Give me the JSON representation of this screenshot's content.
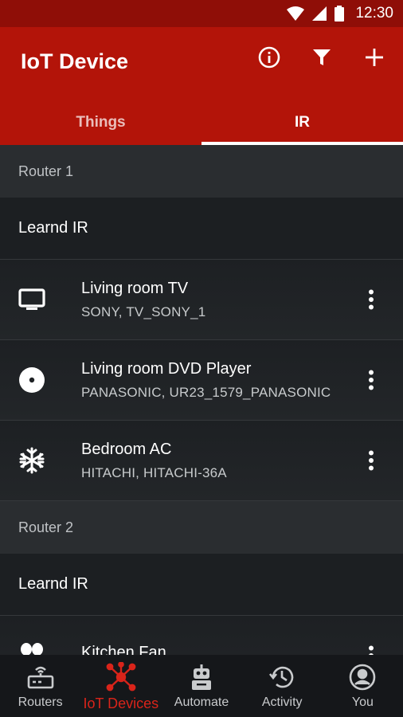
{
  "status_bar": {
    "time": "12:30"
  },
  "app_bar": {
    "title": "IoT Device"
  },
  "tabs": [
    {
      "label": "Things",
      "active": false
    },
    {
      "label": "IR",
      "active": true
    }
  ],
  "sections": [
    {
      "router": "Router 1",
      "learned_label": "Learnd IR",
      "devices": [
        {
          "name": "Living room TV",
          "detail": "SONY, TV_SONY_1",
          "icon": "tv-icon"
        },
        {
          "name": "Living room DVD Player",
          "detail": "PANASONIC, UR23_1579_PANASONIC",
          "icon": "disc-icon"
        },
        {
          "name": "Bedroom AC",
          "detail": "HITACHI, HITACHI-36A",
          "icon": "snowflake-icon"
        }
      ]
    },
    {
      "router": "Router 2",
      "learned_label": "Learnd IR",
      "devices": [
        {
          "name": "Kitchen Fan",
          "detail": "",
          "icon": "fan-icon"
        }
      ]
    }
  ],
  "bottom_nav": [
    {
      "label": "Routers",
      "icon": "router-icon",
      "active": false
    },
    {
      "label": "IoT Devices",
      "icon": "iot-network-icon",
      "active": true
    },
    {
      "label": "Automate",
      "icon": "robot-icon",
      "active": false
    },
    {
      "label": "Activity",
      "icon": "history-icon",
      "active": false
    },
    {
      "label": "You",
      "icon": "account-icon",
      "active": false
    }
  ],
  "colors": {
    "primary": "#b31409",
    "primary_dark": "#8f0e07",
    "accent_active": "#d9241a",
    "background": "#1e2124"
  }
}
